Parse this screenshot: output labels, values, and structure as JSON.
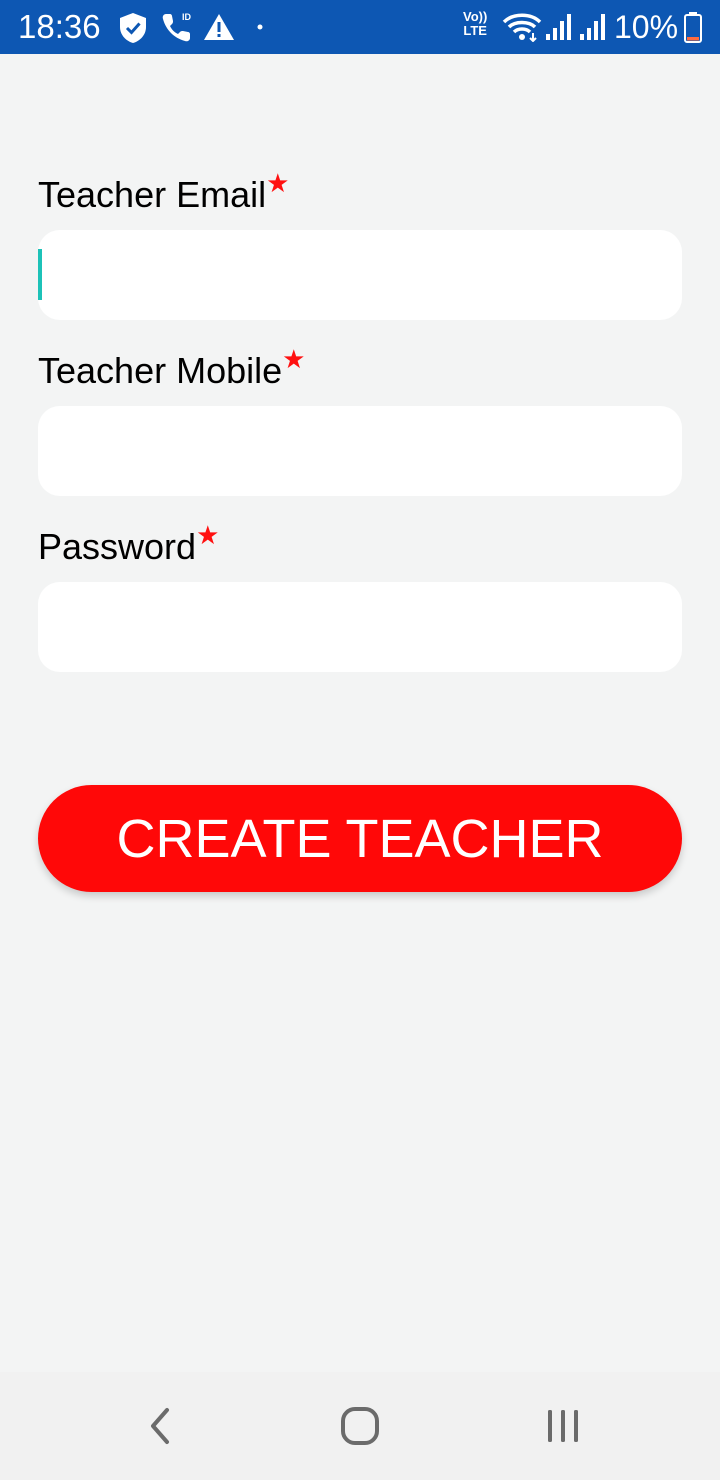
{
  "status_bar": {
    "time": "18:36",
    "battery": "10%",
    "volte_top": "Vo))",
    "volte_bottom": "LTE",
    "icons": [
      "shield-icon",
      "wifi-calling-icon",
      "warning-icon",
      "notification-dot-icon",
      "volte-icon",
      "wifi-icon",
      "signal-icon",
      "signal-icon",
      "battery-icon"
    ],
    "bg_color": "#0d57b3"
  },
  "form": {
    "email_label": "Teacher Email",
    "mobile_label": "Teacher Mobile",
    "password_label": "Password",
    "required_marker": "★",
    "email_value": "",
    "mobile_value": "",
    "password_value": ""
  },
  "actions": {
    "create_label": "CREATE TEACHER",
    "button_color": "#ff0808"
  },
  "nav_bar": {
    "icons": [
      "back-icon",
      "home-icon",
      "recents-icon"
    ]
  }
}
